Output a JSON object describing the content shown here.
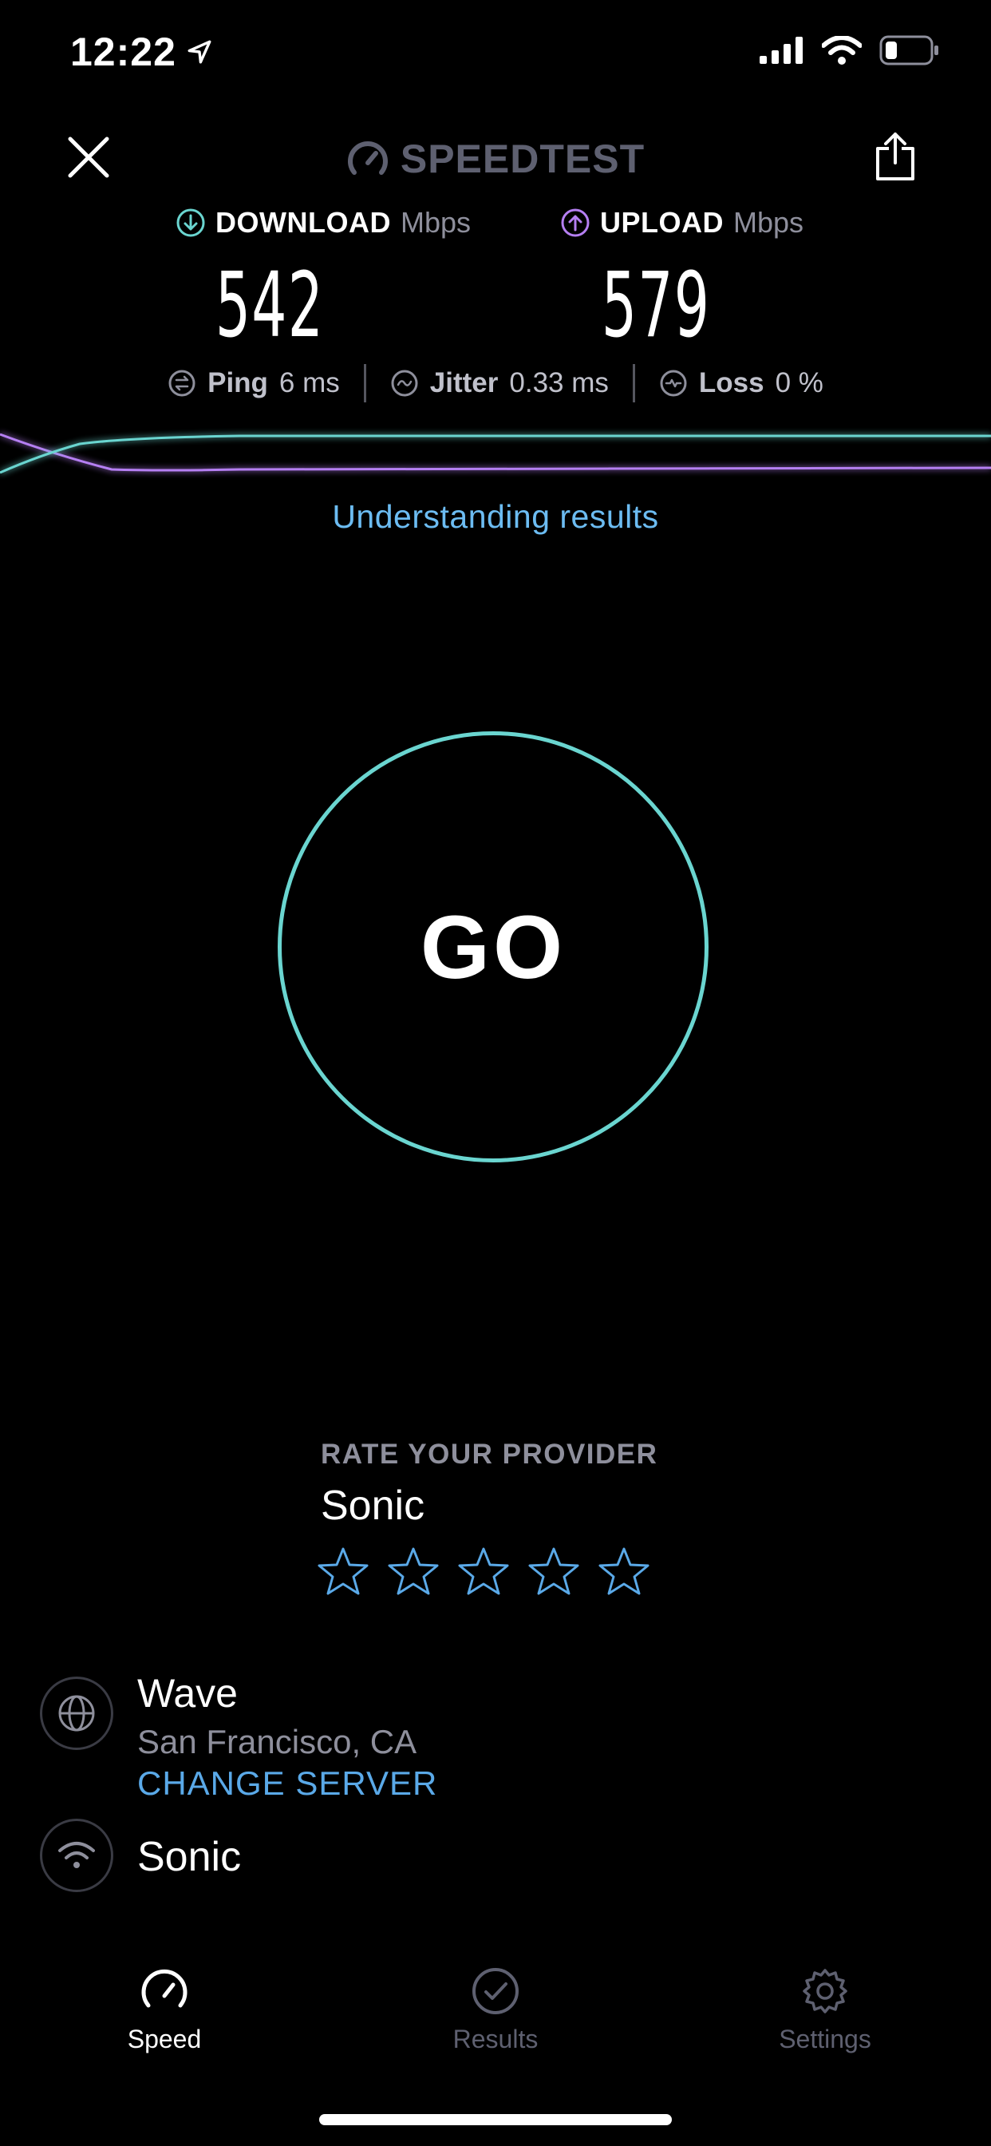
{
  "status_bar": {
    "time": "12:22",
    "icons": [
      "location-arrow-icon",
      "cellular-signal-icon",
      "wifi-icon",
      "battery-icon"
    ]
  },
  "header": {
    "brand": "SPEEDTEST",
    "close_icon": "close-icon",
    "share_icon": "share-icon"
  },
  "metrics": {
    "download": {
      "label": "DOWNLOAD",
      "unit": "Mbps",
      "value": "542",
      "color": "#6ad5d0"
    },
    "upload": {
      "label": "UPLOAD",
      "unit": "Mbps",
      "value": "579",
      "color": "#b57ff2"
    }
  },
  "stats": {
    "ping": {
      "label": "Ping",
      "value": "6 ms"
    },
    "jitter": {
      "label": "Jitter",
      "value": "0.33 ms"
    },
    "loss": {
      "label": "Loss",
      "value": "0 %"
    }
  },
  "understanding_link": "Understanding results",
  "go_button": {
    "label": "GO",
    "ring_color": "#6ad5d0"
  },
  "rate": {
    "title": "RATE YOUR PROVIDER",
    "provider": "Sonic",
    "stars_total": 5,
    "stars_selected": 0,
    "star_color": "#5aa9e8"
  },
  "server": {
    "name": "Wave",
    "location": "San Francisco, CA",
    "change_label": "CHANGE SERVER"
  },
  "isp": {
    "name": "Sonic"
  },
  "tabs": [
    {
      "label": "Speed",
      "icon": "speedometer-icon",
      "active": true
    },
    {
      "label": "Results",
      "icon": "checkmark-circle-icon",
      "active": false
    },
    {
      "label": "Settings",
      "icon": "gear-icon",
      "active": false
    }
  ],
  "colors": {
    "background": "#000000",
    "accent_teal": "#6ad5d0",
    "accent_purple": "#b57ff2",
    "link_blue": "#6cbcf2",
    "muted": "#8e8f9c"
  }
}
